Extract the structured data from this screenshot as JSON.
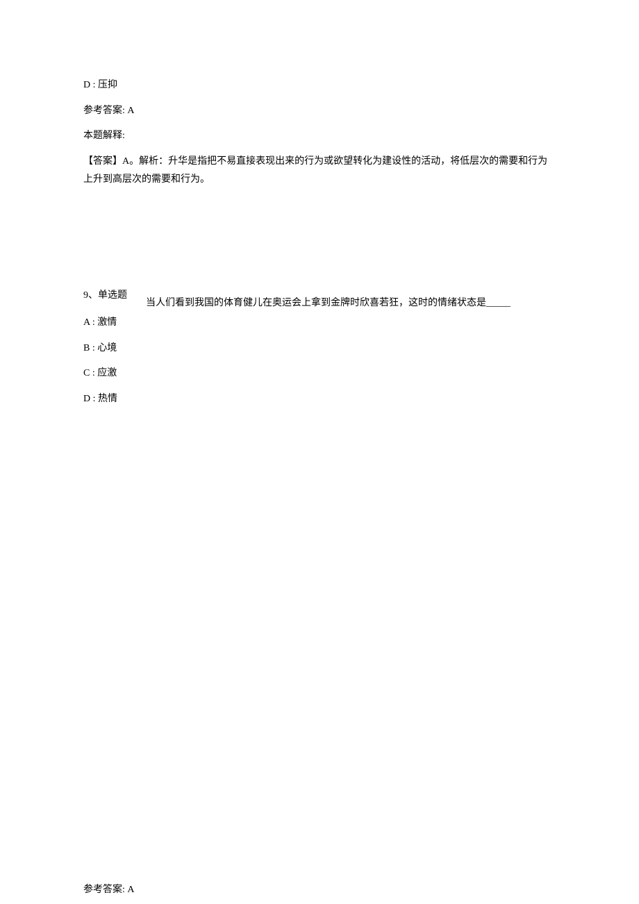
{
  "q8": {
    "option_d": "D : 压抑",
    "answer_label": "参考答案: A",
    "explain_label": "本题解释:",
    "explain_text": "【答案】A。解析：升华是指把不易直接表现出来的行为或欲望转化为建设性的活动，将低层次的需要和行为上升到高层次的需要和行为。"
  },
  "q9": {
    "header": "9、单选题",
    "stem": "当人们看到我国的体育健儿在奥运会上拿到金牌时欣喜若狂，这时的情绪状态是_____",
    "option_a": "A : 激情",
    "option_b": "B : 心境",
    "option_c": "C : 应激",
    "option_d": "D : 热情",
    "answer_label": "参考答案: A"
  }
}
